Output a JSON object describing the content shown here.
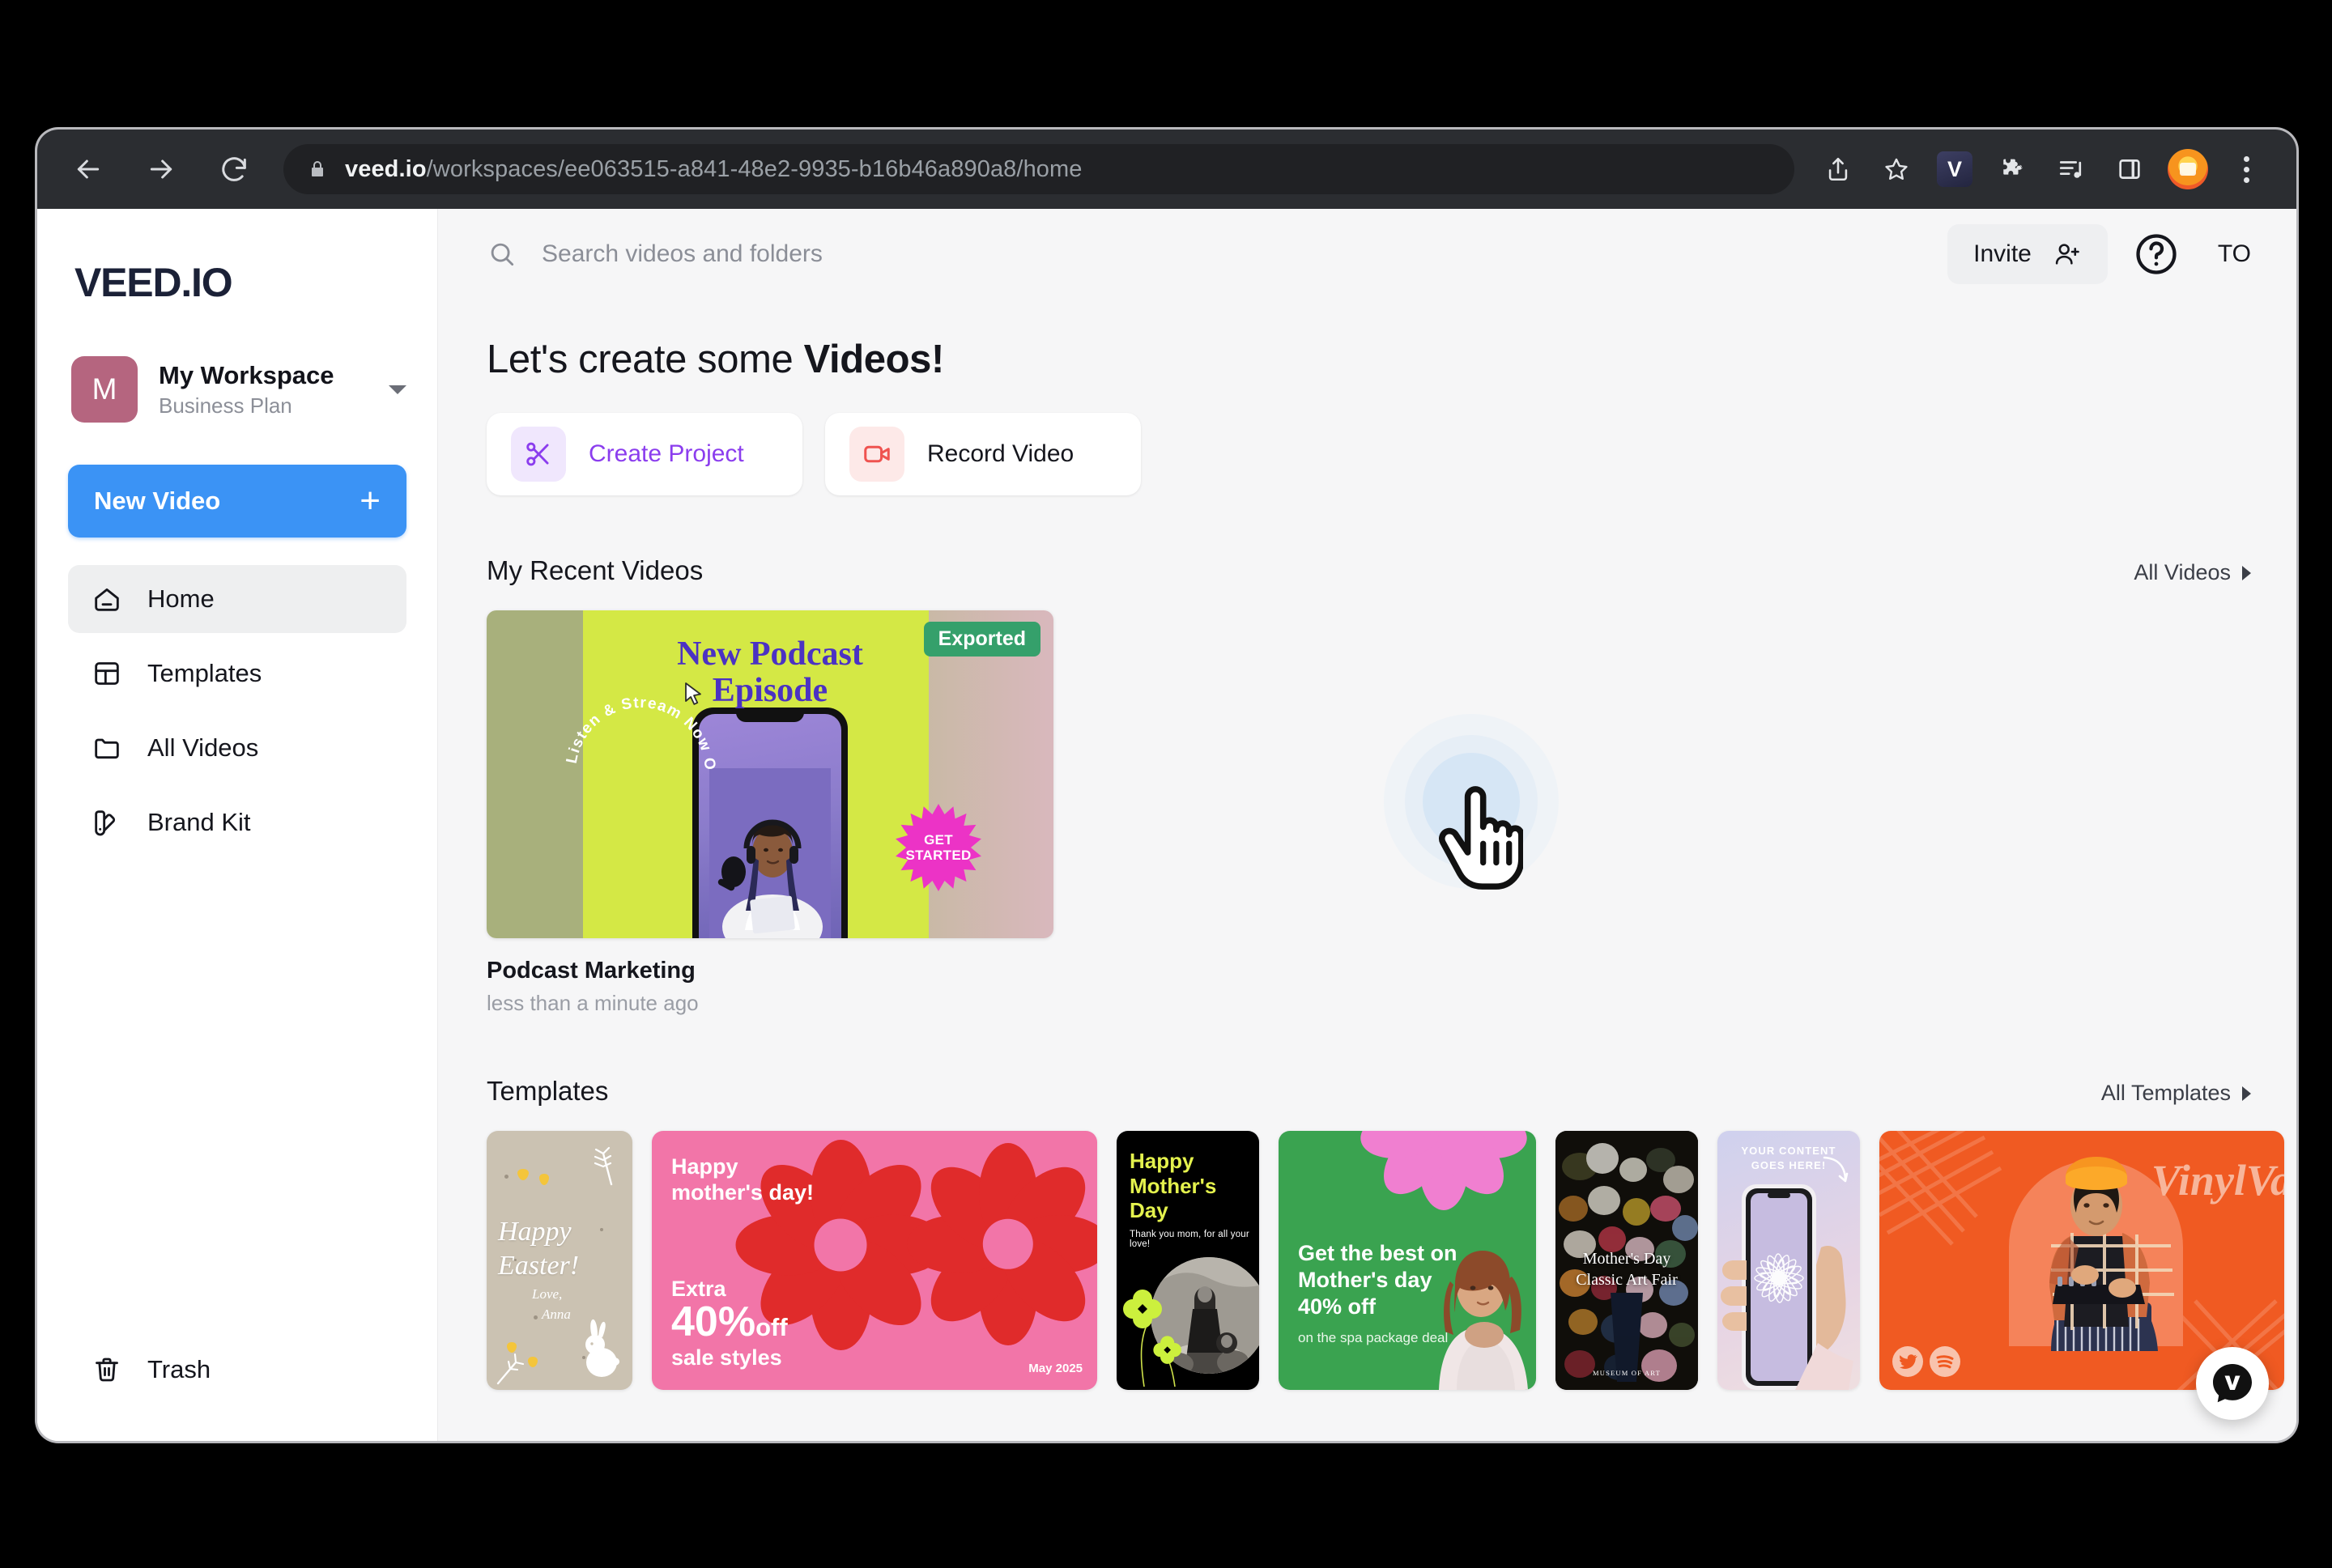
{
  "browser": {
    "url_domain": "veed.io",
    "url_path": "/workspaces/ee063515-a841-48e2-9935-b16b46a890a8/home",
    "back_icon": "back-arrow-icon",
    "forward_icon": "forward-arrow-icon",
    "reload_icon": "reload-icon",
    "lock_icon": "lock-icon",
    "share_icon": "share-icon",
    "bookmark_icon": "star-icon",
    "extension_veed_label": "V",
    "extensions_icon": "puzzle-piece-icon",
    "reading_list_icon": "reading-list-icon",
    "side_panel_icon": "side-panel-icon",
    "profile_icon": "profile-avatar-icon",
    "menu_icon": "three-dot-menu-icon"
  },
  "sidebar": {
    "logo": "VEED.IO",
    "workspace": {
      "initial": "M",
      "name": "My Workspace",
      "plan": "Business Plan",
      "caret_icon": "chevron-down-icon"
    },
    "new_video_label": "New Video",
    "new_video_plus": "+",
    "items": [
      {
        "label": "Home",
        "icon": "home-icon",
        "active": true
      },
      {
        "label": "Templates",
        "icon": "templates-icon",
        "active": false
      },
      {
        "label": "All Videos",
        "icon": "folder-icon",
        "active": false
      },
      {
        "label": "Brand Kit",
        "icon": "brand-kit-icon",
        "active": false
      }
    ],
    "trash": {
      "label": "Trash",
      "icon": "trash-icon"
    }
  },
  "topbar": {
    "search_placeholder": "Search videos and folders",
    "search_value": "",
    "search_icon": "search-icon",
    "invite_label": "Invite",
    "invite_icon": "add-person-icon",
    "help_icon": "help-circle-icon",
    "user_initials": "TO"
  },
  "hero": {
    "headline_normal": "Let's create some ",
    "headline_bold": "Videos!",
    "actions": [
      {
        "label": "Create Project",
        "icon": "scissors-icon",
        "style": "purple"
      },
      {
        "label": "Record Video",
        "icon": "camcorder-icon",
        "style": "red"
      }
    ]
  },
  "recent": {
    "section_title": "My Recent Videos",
    "link_label": "All Videos",
    "video": {
      "name": "Podcast Marketing",
      "time": "less than a minute ago",
      "badge": "Exported",
      "badge_color": "#35a06b",
      "thumb_title_line1": "New Podcast",
      "thumb_title_line2": "Episode",
      "thumb_circular_text": "Listen & Stream Now On",
      "thumb_starburst_line1": "GET",
      "thumb_starburst_line2": "STARTED",
      "starburst_color": "#ec33c6"
    }
  },
  "templates": {
    "section_title": "Templates",
    "link_label": "All Templates",
    "items": [
      {
        "name": "happy-easter",
        "bg": "#cbc2b2",
        "lines": [
          "Happy",
          "Easter!",
          "Love,",
          "Anna"
        ]
      },
      {
        "name": "mothers-day-sale-pink",
        "bg": "#f275a8",
        "lines": [
          "Happy",
          "mother's day!",
          "Extra",
          "40%",
          "off",
          "sale styles",
          "May 2025"
        ]
      },
      {
        "name": "mothers-day-black",
        "bg": "#000000",
        "lines": [
          "Happy",
          "Mother's",
          "Day",
          "Thank you mom, for all your love!"
        ]
      },
      {
        "name": "spa-package-green",
        "bg": "#3aa350",
        "lines": [
          "Get the best on",
          "Mother's day",
          "40% off",
          "on the spa package deal"
        ]
      },
      {
        "name": "classic-art-fair",
        "bg": "#1d1a14",
        "lines": [
          "Mother's Day",
          "Classic Art Fair",
          "MUSEUM OF ART"
        ]
      },
      {
        "name": "your-content-phone",
        "bg": "#d9d3ea",
        "lines": [
          "YOUR CONTENT",
          "GOES HERE!"
        ]
      },
      {
        "name": "vinyl-vault-orange",
        "bg": "#f05a22",
        "lines": [
          "VinylVault"
        ]
      }
    ]
  },
  "widget": {
    "label": "V",
    "icon": "veed-chat-bubble-icon"
  },
  "cursor": {
    "icon": "pointing-hand-cursor",
    "state": "click-ripple"
  }
}
